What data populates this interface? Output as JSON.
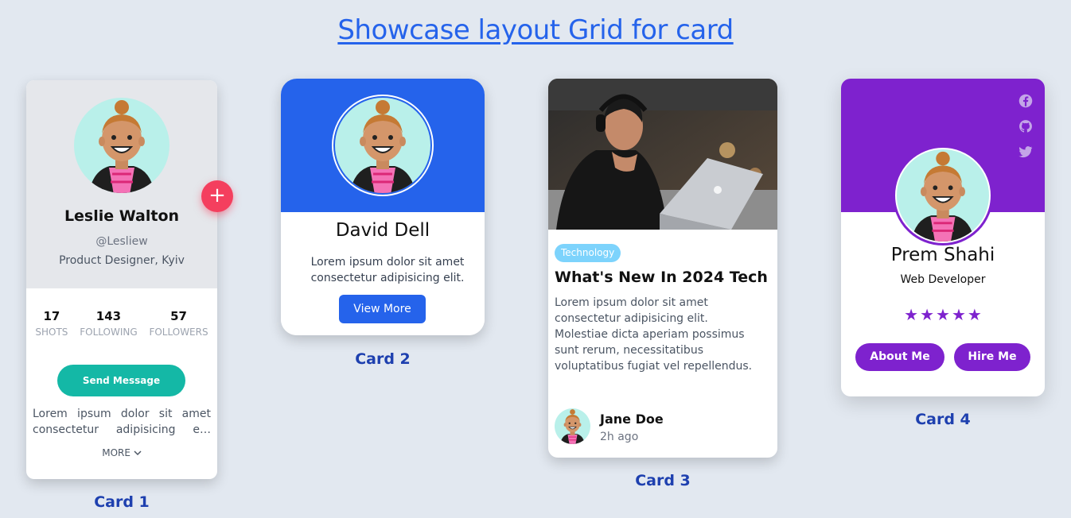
{
  "page": {
    "title": "Showcase layout Grid for card"
  },
  "colors": {
    "background": "#e2e8f0",
    "blue": "#2563eb",
    "teal": "#14b8a6",
    "pink": "#f43f5e",
    "purple": "#7e22ce",
    "caption": "#1e40af"
  },
  "card1": {
    "caption": "Card 1",
    "name": "Leslie Walton",
    "handle": "@Lesliew",
    "role": "Product Designer, Kyiv",
    "plus_icon": "+",
    "stats": [
      {
        "value": "17",
        "label": "SHOTS"
      },
      {
        "value": "143",
        "label": "FOLLOWING"
      },
      {
        "value": "57",
        "label": "FOLLOWERS"
      }
    ],
    "button": "Send Message",
    "description": "Lorem ipsum dolor sit amet consectetur adipisicing e…",
    "more": "MORE"
  },
  "card2": {
    "caption": "Card 2",
    "name": "David Dell",
    "description": "Lorem ipsum dolor sit amet consectetur adipisicing elit. Atque…",
    "button": "View More"
  },
  "card3": {
    "caption": "Card 3",
    "tag": "Technology",
    "headline": "What's New In 2024 Tech",
    "body": "Lorem ipsum dolor sit amet consectetur adipisicing elit. Molestiae dicta aperiam possimus sunt rerum, necessitatibus voluptatibus fugiat vel repellendus.",
    "author": "Jane Doe",
    "time": "2h ago"
  },
  "card4": {
    "caption": "Card 4",
    "name": "Prem Shahi",
    "role": "Web Developer",
    "rating": 5,
    "social_icons": [
      "facebook-icon",
      "github-icon",
      "twitter-icon"
    ],
    "buttons": [
      "About Me",
      "Hire Me"
    ]
  }
}
